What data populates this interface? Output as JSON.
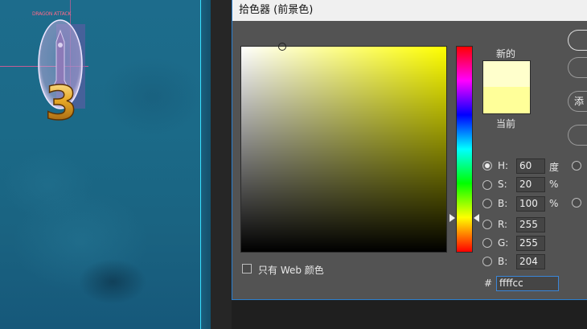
{
  "canvas": {
    "sprite_label": "DRAGON ATTACK",
    "sprite_number": "3"
  },
  "dialog": {
    "title": "拾色器 (前景色)",
    "new_label": "新的",
    "current_label": "当前",
    "new_color": "#ffffcc",
    "current_color": "#ffff99",
    "fields": {
      "h": {
        "label": "H:",
        "value": "60",
        "unit": "度",
        "selected": true
      },
      "s": {
        "label": "S:",
        "value": "20",
        "unit": "%",
        "selected": false
      },
      "b": {
        "label": "B:",
        "value": "100",
        "unit": "%",
        "selected": false
      },
      "r": {
        "label": "R:",
        "value": "255",
        "selected": false
      },
      "g": {
        "label": "G:",
        "value": "255",
        "selected": false
      },
      "b2": {
        "label": "B:",
        "value": "204",
        "selected": false
      }
    },
    "hex_label": "#",
    "hex_value": "ffffcc",
    "web_only_label": "只有 Web 颜色",
    "web_only_checked": false,
    "buttons": {
      "ok": "",
      "cancel": "",
      "add_swatch": "添",
      "libraries": ""
    },
    "colors": {
      "dialog_bg": "#535353",
      "titlebar_bg": "#f0f0f0",
      "accent": "#2a7fd0",
      "guide": "#38e0ff"
    }
  }
}
